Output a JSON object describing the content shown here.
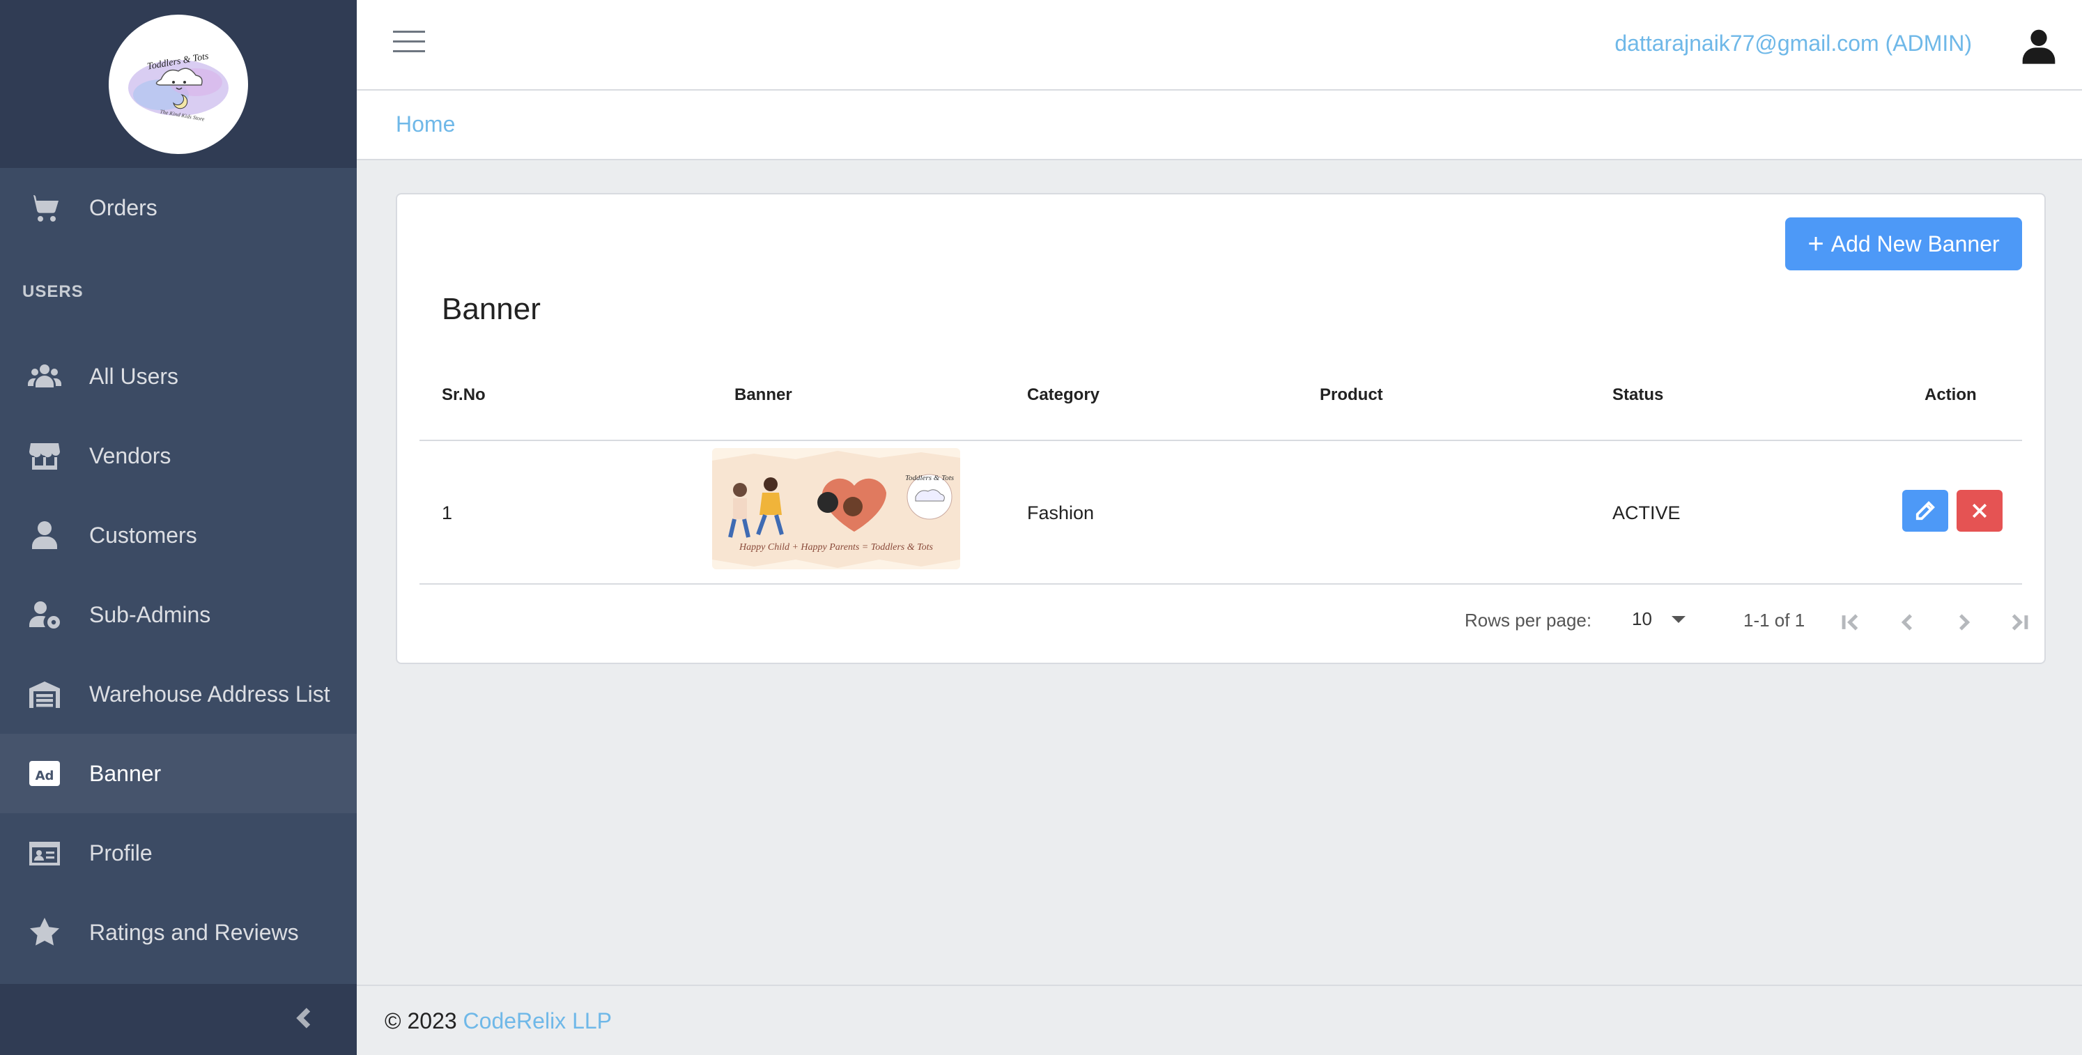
{
  "brand": {
    "logo_text_top": "Toddlers & Tots",
    "logo_text_bottom": "The Kind Kids Store"
  },
  "sidebar": {
    "items_top": [
      {
        "label": "Orders",
        "icon": "cart-icon"
      }
    ],
    "section_title": "USERS",
    "items": [
      {
        "label": "All Users",
        "icon": "users-icon"
      },
      {
        "label": "Vendors",
        "icon": "store-icon"
      },
      {
        "label": "Customers",
        "icon": "user-icon"
      },
      {
        "label": "Sub-Admins",
        "icon": "user-gear-icon"
      },
      {
        "label": "Warehouse Address List",
        "icon": "warehouse-icon"
      },
      {
        "label": "Banner",
        "icon": "ad-icon",
        "active": true
      },
      {
        "label": "Profile",
        "icon": "id-card-icon"
      },
      {
        "label": "Ratings and Reviews",
        "icon": "star-icon"
      }
    ],
    "toggle_icon": "chevron-left-icon"
  },
  "header": {
    "user_email": "dattarajnaik77@gmail.com (ADMIN)",
    "breadcrumb_home": "Home"
  },
  "page": {
    "title": "Banner",
    "add_button_label": "Add New Banner"
  },
  "table": {
    "columns": [
      "Sr.No",
      "Banner",
      "Category",
      "Product",
      "Status",
      "Action"
    ],
    "rows": [
      {
        "sr_no": "1",
        "banner_text": "Happy Child + Happy Parents = Toddlers & Tots",
        "category": "Fashion",
        "product": "",
        "status": "ACTIVE"
      }
    ]
  },
  "pagination": {
    "rows_per_page_label": "Rows per page:",
    "rows_per_page_value": "10",
    "range": "1-1 of 1"
  },
  "footer": {
    "copyright": "© 2023",
    "company": "CodeRelix LLP"
  },
  "colors": {
    "sidebar_bg": "#3c4b64",
    "primary": "#4d99f7",
    "danger": "#e55353",
    "link": "#6fb8e8"
  }
}
